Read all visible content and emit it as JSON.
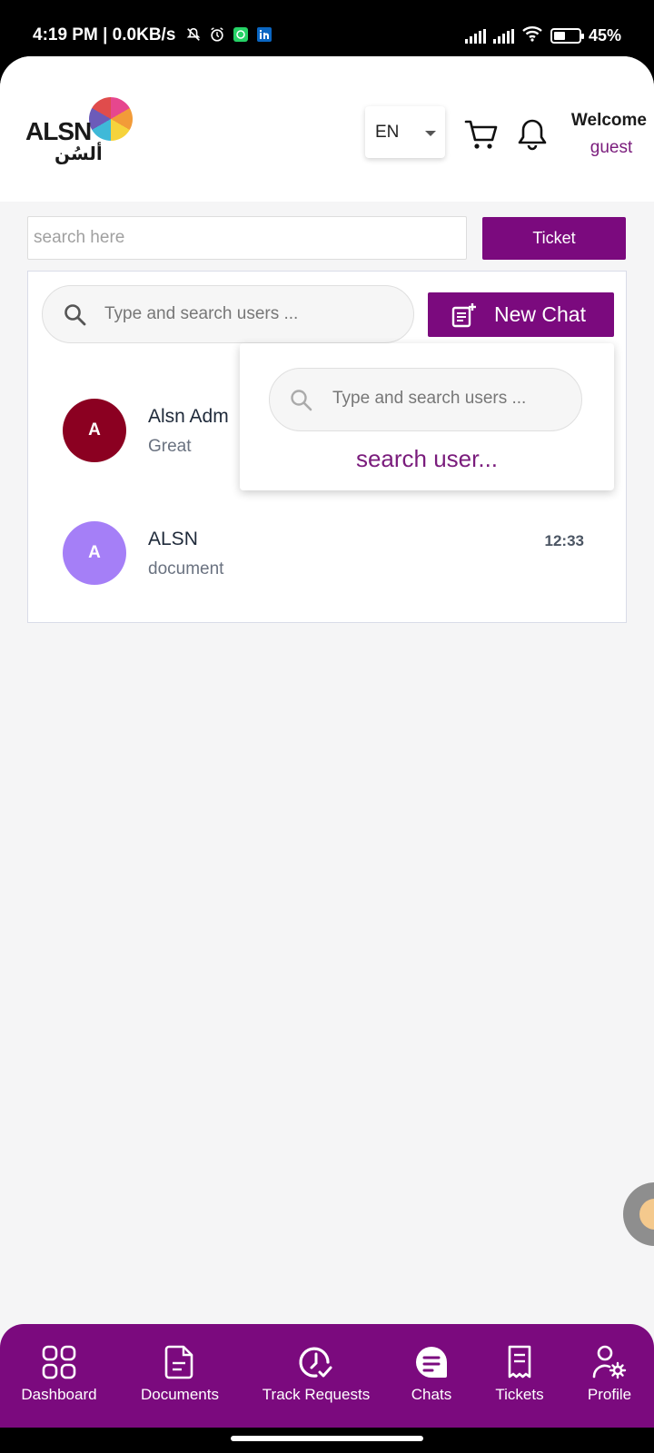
{
  "status_bar": {
    "time_net": "4:19 PM | 0.0KB/s",
    "battery": "45%",
    "battery_level": 0.45,
    "icons": [
      "mute-icon",
      "alarm-icon",
      "whatsapp-icon",
      "linkedin-icon",
      "signal-icon",
      "signal-icon",
      "wifi-icon",
      "battery-icon"
    ]
  },
  "header": {
    "logo_text": "ALSN",
    "logo_text_ar": "ألسُن",
    "language": "EN",
    "welcome_title": "Welcome",
    "welcome_user": "guest"
  },
  "search": {
    "placeholder": "search here",
    "ticket_label": "Ticket"
  },
  "chat_panel": {
    "search_placeholder": "Type and search users ...",
    "new_chat_label": "New Chat",
    "chats": [
      {
        "avatar": "A",
        "name": "Alsn Adm",
        "message": "Great",
        "time": "",
        "color": "#8b0021"
      },
      {
        "avatar": "A",
        "name": "ALSN",
        "message": "document",
        "time": "12:33",
        "color": "#a57ff7"
      }
    ]
  },
  "dropdown": {
    "search_placeholder": "Type and search users ...",
    "hint": "search user..."
  },
  "bottom_nav": [
    {
      "label": "Dashboard",
      "icon": "grid-icon"
    },
    {
      "label": "Documents",
      "icon": "document-icon"
    },
    {
      "label": "Track Requests",
      "icon": "clock-check-icon"
    },
    {
      "label": "Chats",
      "icon": "chat-icon"
    },
    {
      "label": "Tickets",
      "icon": "receipt-icon"
    },
    {
      "label": "Profile",
      "icon": "user-gear-icon"
    }
  ],
  "colors": {
    "primary": "#7b0a7e",
    "accent_text": "#7a1c7c",
    "background": "#f5f5f6"
  }
}
